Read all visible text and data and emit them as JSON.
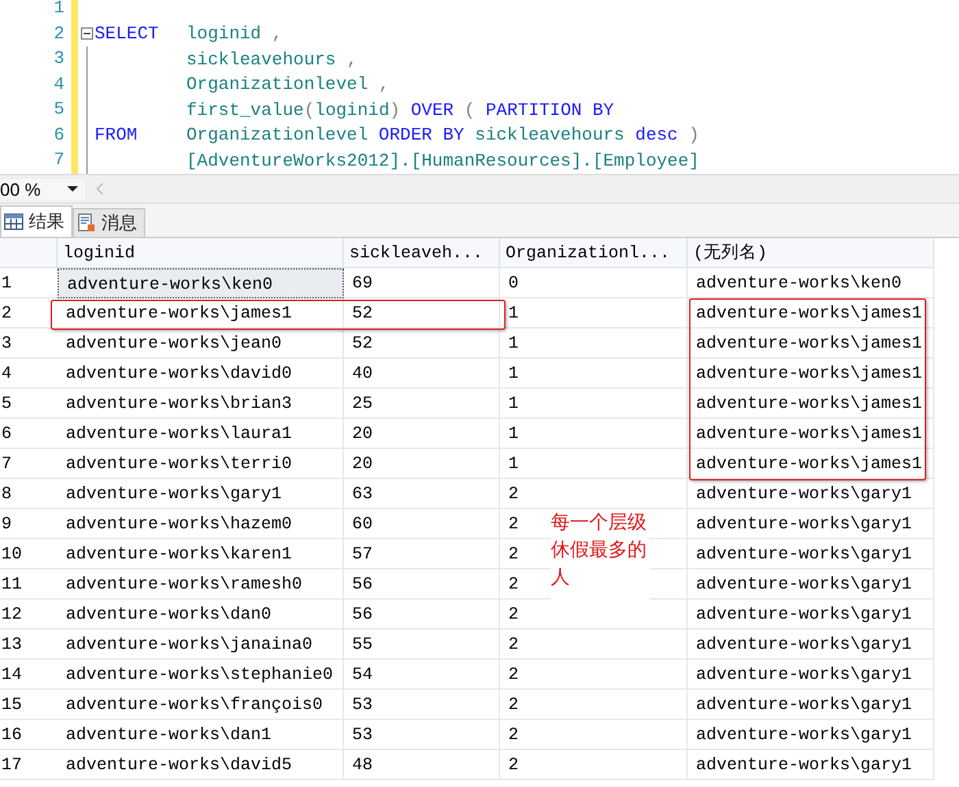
{
  "editor": {
    "lines": [
      {
        "number": "1"
      },
      {
        "number": "2",
        "lead": "SELECT",
        "tokens": [
          {
            "t": "loginid",
            "kind": "name"
          },
          {
            "t": ",",
            "kind": "punct"
          }
        ]
      },
      {
        "number": "3",
        "tokens": [
          {
            "t": "sickleavehours",
            "kind": "name"
          },
          {
            "t": ",",
            "kind": "punct"
          }
        ]
      },
      {
        "number": "4",
        "tokens": [
          {
            "t": "Organizationlevel",
            "kind": "name"
          },
          {
            "t": ",",
            "kind": "punct"
          }
        ]
      },
      {
        "number": "5",
        "tokens": [
          {
            "t": "first_value",
            "kind": "name"
          },
          {
            "t": "(",
            "kind": "call-open"
          },
          {
            "t": "loginid",
            "kind": "name"
          },
          {
            "t": ")",
            "kind": "call-close"
          },
          {
            "t": "OVER",
            "kind": "keyword"
          },
          {
            "t": "(",
            "kind": "punct"
          },
          {
            "t": "PARTITION BY",
            "kind": "keyword"
          }
        ]
      },
      {
        "number": "6",
        "lead": "FROM",
        "tokens": [
          {
            "t": "Organizationlevel",
            "kind": "name"
          },
          {
            "t": "ORDER BY",
            "kind": "keyword"
          },
          {
            "t": "sickleavehours",
            "kind": "name"
          },
          {
            "t": "desc",
            "kind": "keyword"
          },
          {
            "t": ")",
            "kind": "punct"
          }
        ]
      },
      {
        "number": "7",
        "tokens": [
          {
            "t": "[AdventureWorks2012].[HumanResources].[Employee]",
            "kind": "name"
          }
        ]
      }
    ]
  },
  "zoom": {
    "value": "00 %"
  },
  "tabs": [
    {
      "label": "结果",
      "selected": true
    },
    {
      "label": "消息",
      "selected": false
    }
  ],
  "table": {
    "columns": [
      "loginid",
      "sickleaveh...",
      "Organizationl...",
      "(无列名)"
    ],
    "rows": [
      {
        "number": "1",
        "selected": true,
        "cells": [
          "adventure-works\\ken0",
          "69",
          "0",
          "adventure-works\\ken0"
        ]
      },
      {
        "number": "2",
        "selected": false,
        "cells": [
          "adventure-works\\james1",
          "52",
          "1",
          "adventure-works\\james1"
        ]
      },
      {
        "number": "3",
        "selected": false,
        "cells": [
          "adventure-works\\jean0",
          "52",
          "1",
          "adventure-works\\james1"
        ]
      },
      {
        "number": "4",
        "selected": false,
        "cells": [
          "adventure-works\\david0",
          "40",
          "1",
          "adventure-works\\james1"
        ]
      },
      {
        "number": "5",
        "selected": false,
        "cells": [
          "adventure-works\\brian3",
          "25",
          "1",
          "adventure-works\\james1"
        ]
      },
      {
        "number": "6",
        "selected": false,
        "cells": [
          "adventure-works\\laura1",
          "20",
          "1",
          "adventure-works\\james1"
        ]
      },
      {
        "number": "7",
        "selected": false,
        "cells": [
          "adventure-works\\terri0",
          "20",
          "1",
          "adventure-works\\james1"
        ]
      },
      {
        "number": "8",
        "selected": false,
        "cells": [
          "adventure-works\\gary1",
          "63",
          "2",
          "adventure-works\\gary1"
        ]
      },
      {
        "number": "9",
        "selected": false,
        "cells": [
          "adventure-works\\hazem0",
          "60",
          "2",
          "adventure-works\\gary1"
        ]
      },
      {
        "number": "10",
        "selected": false,
        "cells": [
          "adventure-works\\karen1",
          "57",
          "2",
          "adventure-works\\gary1"
        ]
      },
      {
        "number": "11",
        "selected": false,
        "cells": [
          "adventure-works\\ramesh0",
          "56",
          "2",
          "adventure-works\\gary1"
        ]
      },
      {
        "number": "12",
        "selected": false,
        "cells": [
          "adventure-works\\dan0",
          "56",
          "2",
          "adventure-works\\gary1"
        ]
      },
      {
        "number": "13",
        "selected": false,
        "cells": [
          "adventure-works\\janaina0",
          "55",
          "2",
          "adventure-works\\gary1"
        ]
      },
      {
        "number": "14",
        "selected": false,
        "cells": [
          "adventure-works\\stephanie0",
          "54",
          "2",
          "adventure-works\\gary1"
        ]
      },
      {
        "number": "15",
        "selected": false,
        "cells": [
          "adventure-works\\françois0",
          "53",
          "2",
          "adventure-works\\gary1"
        ]
      },
      {
        "number": "16",
        "selected": false,
        "cells": [
          "adventure-works\\dan1",
          "53",
          "2",
          "adventure-works\\gary1"
        ]
      },
      {
        "number": "17",
        "selected": false,
        "cells": [
          "adventure-works\\david5",
          "48",
          "2",
          "adventure-works\\gary1"
        ]
      }
    ]
  },
  "annotation": {
    "text": "每一个层级休假最多的人"
  }
}
